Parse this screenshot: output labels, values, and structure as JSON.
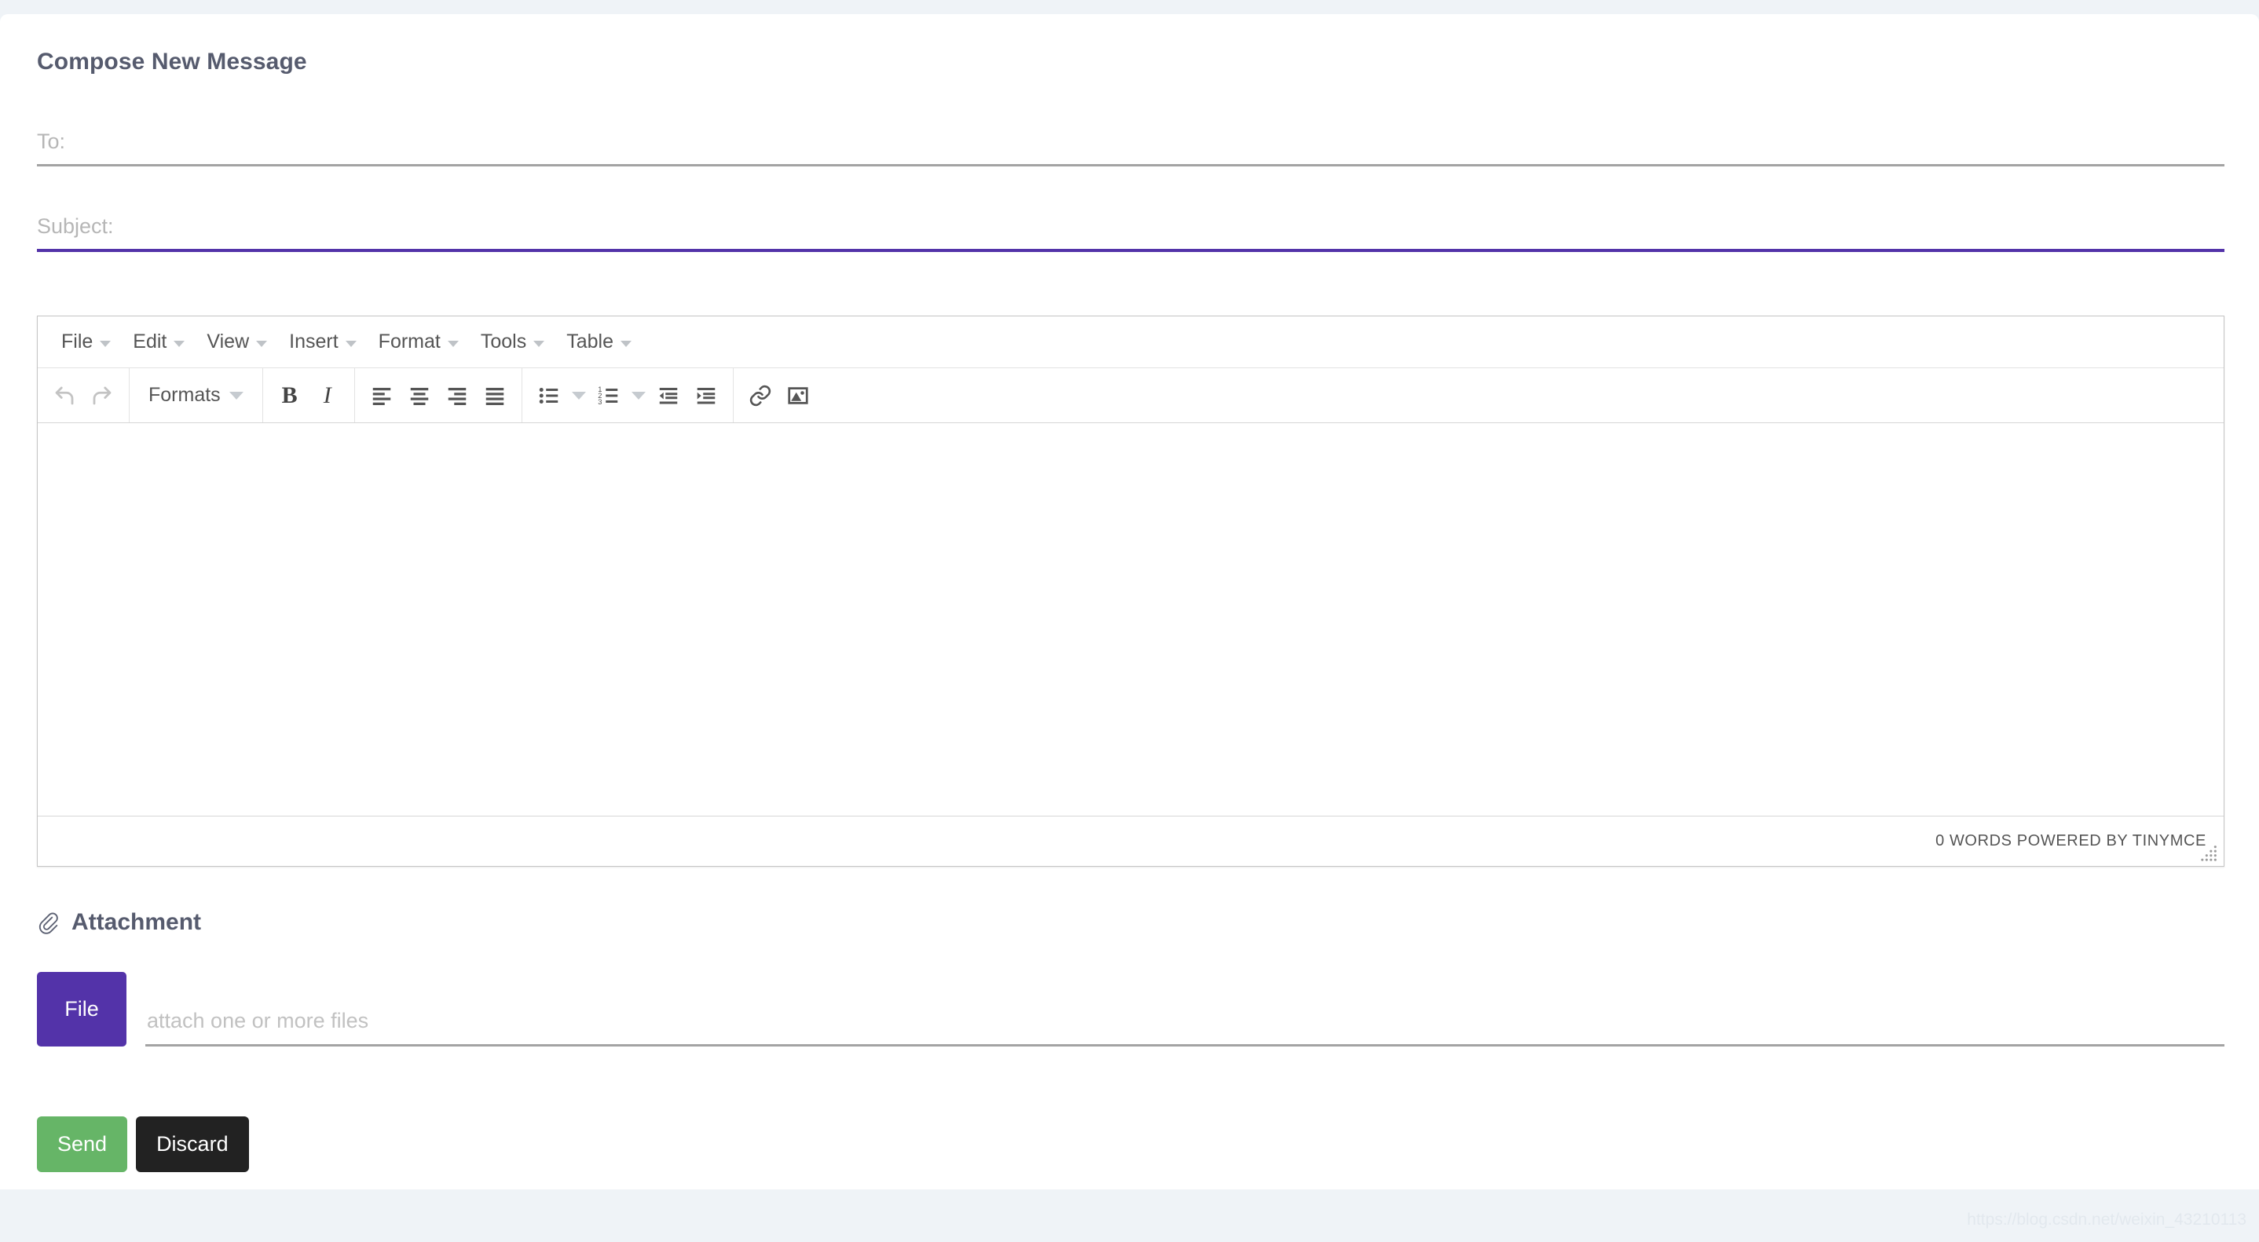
{
  "page": {
    "title": "Compose New Message",
    "background_color": "#eff3f7",
    "accent_color": "#5333a9",
    "watermark": "https://blog.csdn.net/weixin_43210113"
  },
  "fields": {
    "to": {
      "label": "To:",
      "placeholder": "To:",
      "value": ""
    },
    "subject": {
      "label": "Subject:",
      "placeholder": "Subject:",
      "value": ""
    }
  },
  "editor": {
    "menubar": [
      {
        "label": "File",
        "icon": "chevron-down-icon"
      },
      {
        "label": "Edit",
        "icon": "chevron-down-icon"
      },
      {
        "label": "View",
        "icon": "chevron-down-icon"
      },
      {
        "label": "Insert",
        "icon": "chevron-down-icon"
      },
      {
        "label": "Format",
        "icon": "chevron-down-icon"
      },
      {
        "label": "Tools",
        "icon": "chevron-down-icon"
      },
      {
        "label": "Table",
        "icon": "chevron-down-icon"
      }
    ],
    "toolbar": {
      "undo": "undo-icon",
      "redo": "redo-icon",
      "formats_label": "Formats",
      "bold": "B",
      "italic": "I",
      "align_left": "align-left-icon",
      "align_center": "align-center-icon",
      "align_right": "align-right-icon",
      "align_justify": "align-justify-icon",
      "bullet_list": "bullet-list-icon",
      "numbered_list": "numbered-list-icon",
      "outdent": "outdent-icon",
      "indent": "indent-icon",
      "link": "link-icon",
      "image": "image-icon"
    },
    "content": "",
    "statusbar": {
      "word_count": "0 WORDS POWERED BY TINYMCE"
    }
  },
  "attachment": {
    "heading": "Attachment",
    "icon": "paperclip-icon",
    "file_button_label": "File",
    "input_placeholder": "attach one or more files",
    "input_value": ""
  },
  "actions": {
    "send_label": "Send",
    "discard_label": "Discard",
    "send_color": "#66b567",
    "discard_color": "#222222"
  }
}
